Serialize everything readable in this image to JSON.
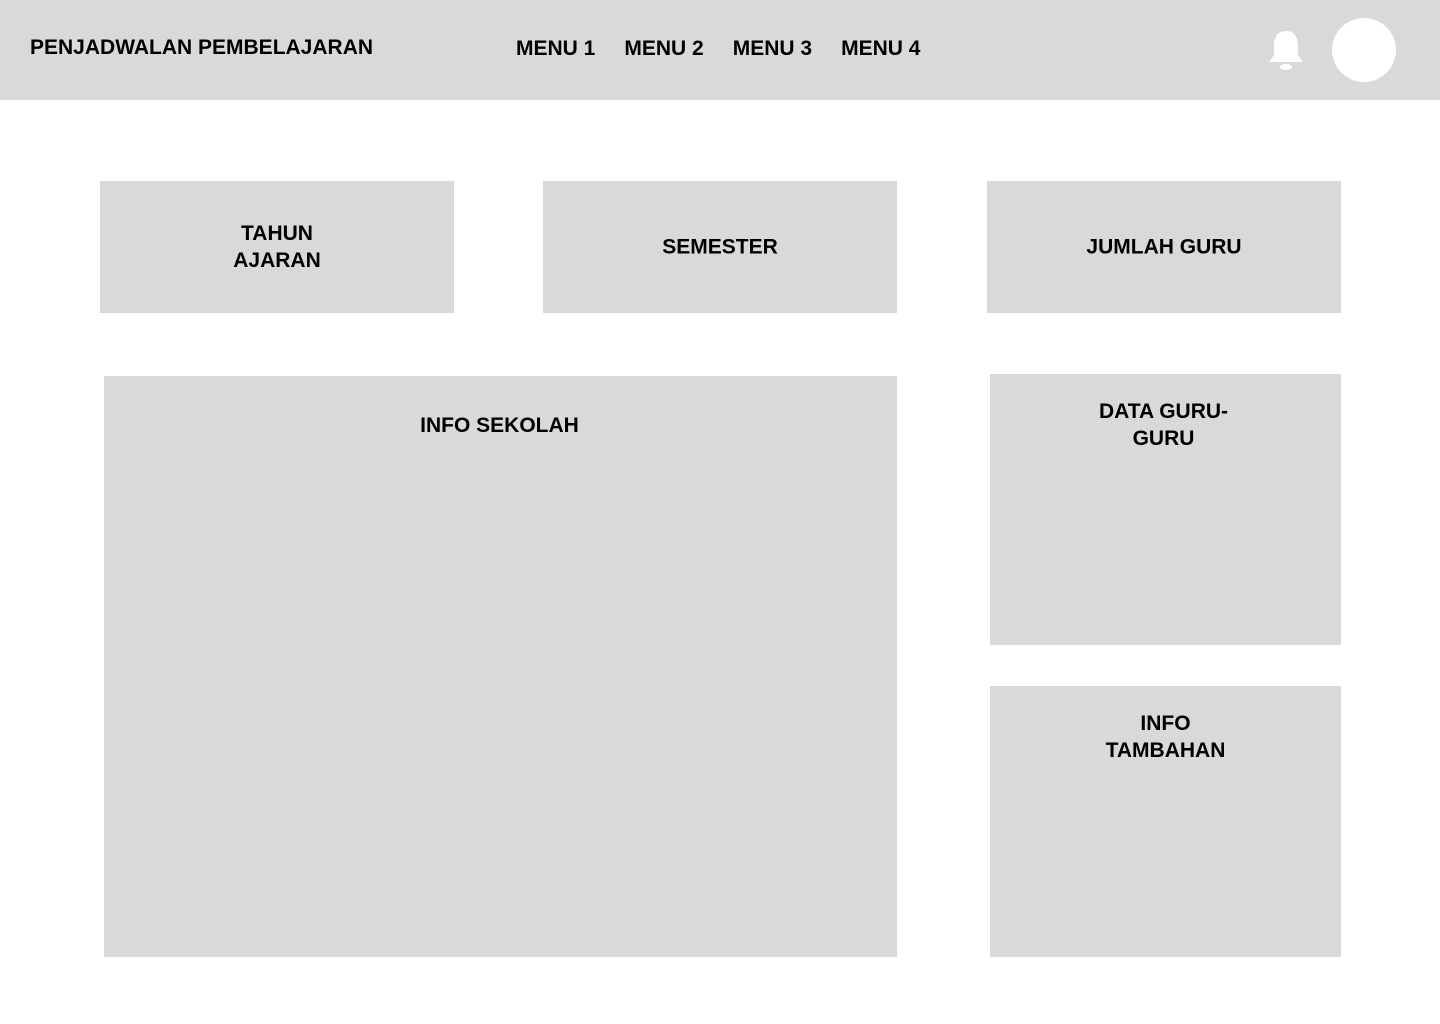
{
  "header": {
    "title": "PENJADWALAN PEMBELAJARAN",
    "menu": [
      {
        "label": "MENU 1"
      },
      {
        "label": "MENU 2"
      },
      {
        "label": "MENU 3"
      },
      {
        "label": "MENU 4"
      }
    ],
    "notification_icon": "bell-icon",
    "avatar_icon": "avatar"
  },
  "stats": {
    "tahun_ajaran": {
      "line1": "TAHUN",
      "line2": "AJARAN"
    },
    "semester": "SEMESTER",
    "jumlah_guru": "JUMLAH GURU"
  },
  "panels": {
    "info_sekolah": "INFO SEKOLAH",
    "data_guru": {
      "line1": "DATA GURU-",
      "line2": "GURU"
    },
    "info_tambahan": {
      "line1": "INFO",
      "line2": "TAMBAHAN"
    }
  },
  "colors": {
    "panel_bg": "#d9d9d9",
    "page_bg": "#ffffff",
    "text": "#000000"
  }
}
